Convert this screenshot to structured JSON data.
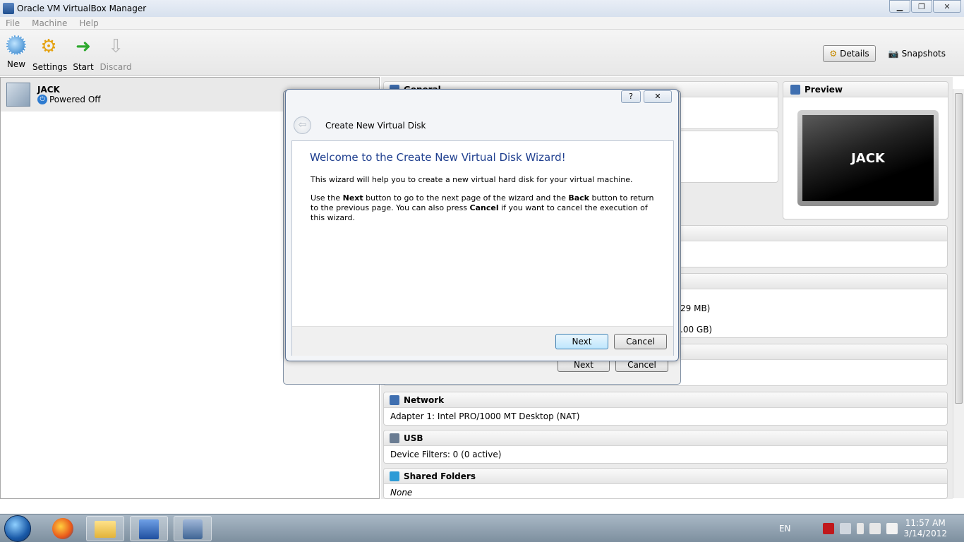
{
  "window": {
    "title": "Oracle VM VirtualBox Manager",
    "minimize": "▁",
    "maximize": "❐",
    "close": "✕"
  },
  "menu": [
    "File",
    "Machine",
    "Help"
  ],
  "toolbar": {
    "new": "New",
    "settings": "Settings",
    "start": "Start",
    "discard": "Discard",
    "details": "Details",
    "snapshots": "Snapshots"
  },
  "vm": {
    "name": "JACK",
    "state": "Powered Off"
  },
  "details": {
    "general": "General",
    "preview": "Preview",
    "preview_name": "JACK",
    "partial_memory": "29 MB)",
    "partial_disk": ".00 GB)",
    "network": {
      "title": "Network",
      "value": "Adapter 1: Intel PRO/1000 MT Desktop (NAT)"
    },
    "usb": {
      "title": "USB",
      "value": "Device Filters: 0 (0 active)"
    },
    "shared": {
      "title": "Shared Folders",
      "value": "None"
    }
  },
  "dialog_back": {
    "next": "Next",
    "cancel": "Cancel"
  },
  "dialog": {
    "help": "?",
    "close": "✕",
    "wizard_title": "Create New Virtual Disk",
    "heading": "Welcome to the Create New Virtual Disk Wizard!",
    "para1": "This wizard will help you to create a new virtual hard disk for your virtual machine.",
    "para2_a": "Use the ",
    "para2_next": "Next",
    "para2_b": " button to go to the next page of the wizard and the ",
    "para2_back": "Back",
    "para2_c": " button to return to the previous page. You can also press ",
    "para2_cancel": "Cancel",
    "para2_d": " if you want to cancel the execution of this wizard.",
    "next": "Next",
    "cancel": "Cancel"
  },
  "taskbar": {
    "lang": "EN",
    "time": "11:57 AM",
    "date": "3/14/2012"
  }
}
